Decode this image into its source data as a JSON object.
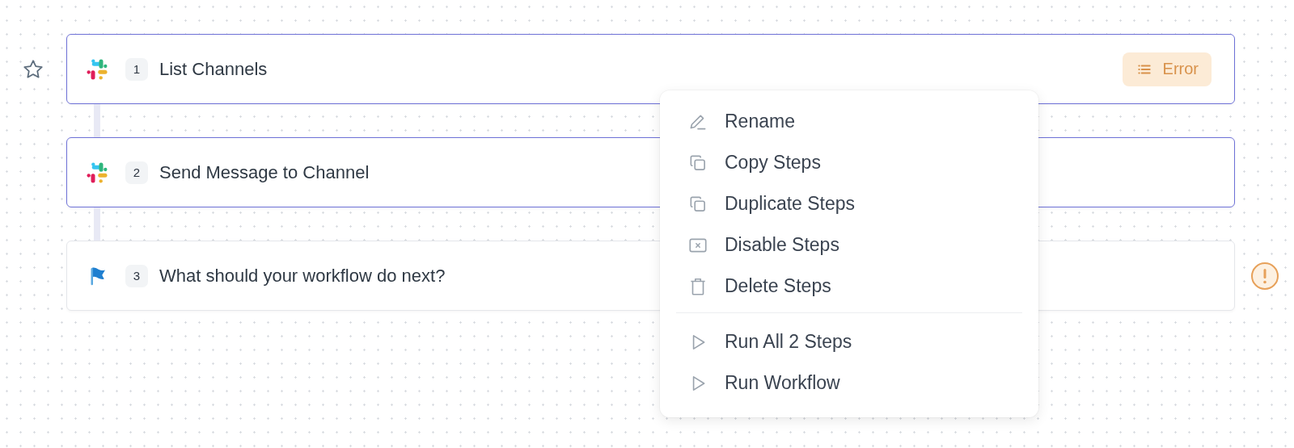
{
  "starred": false,
  "steps": [
    {
      "number": "1",
      "title": "List Channels",
      "kind": "app",
      "selected": true,
      "badge": {
        "label": "Error"
      },
      "warning": false
    },
    {
      "number": "2",
      "title": "Send Message to Channel",
      "kind": "app",
      "selected": true,
      "warning": false
    },
    {
      "number": "3",
      "title": "What should your workflow do next?",
      "kind": "trigger",
      "selected": false,
      "warning": true
    }
  ],
  "context_menu": {
    "groups": [
      [
        {
          "label": "Rename",
          "kind": "rename"
        },
        {
          "label": "Copy Steps",
          "kind": "copy"
        },
        {
          "label": "Duplicate Steps",
          "kind": "copy"
        },
        {
          "label": "Disable Steps",
          "kind": "disable"
        },
        {
          "label": "Delete Steps",
          "kind": "delete"
        }
      ],
      [
        {
          "label": "Run All 2 Steps",
          "kind": "run"
        },
        {
          "label": "Run Workflow",
          "kind": "run"
        }
      ]
    ]
  }
}
